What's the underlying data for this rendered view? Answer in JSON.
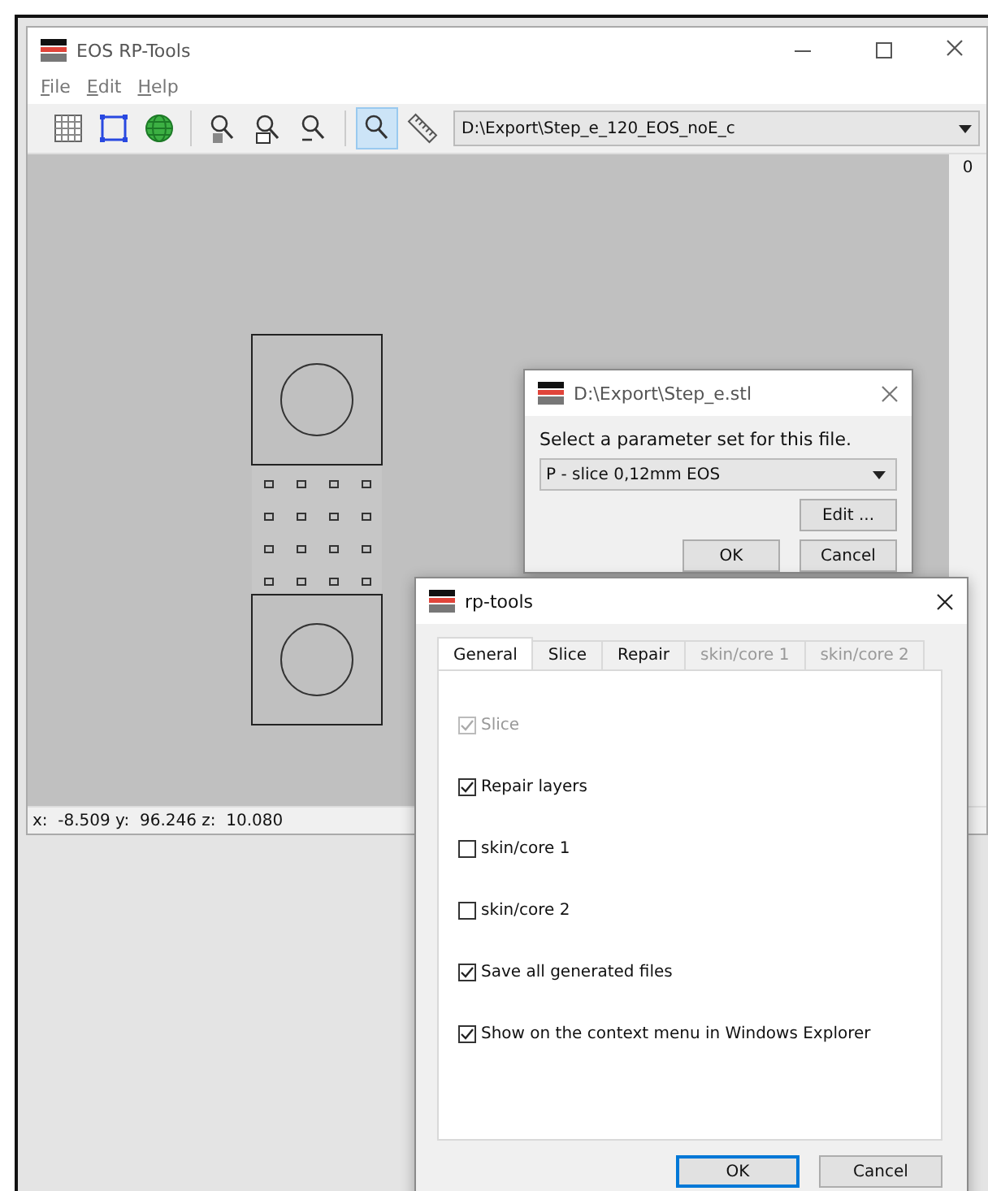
{
  "main_window": {
    "title": "EOS RP-Tools",
    "menu": [
      "File",
      "Edit",
      "Help"
    ],
    "toolbar": [
      {
        "kind": "grid",
        "selected": false
      },
      {
        "kind": "select",
        "selected": false
      },
      {
        "kind": "globe",
        "selected": false
      },
      {
        "kind": "zoom-sel",
        "selected": false
      },
      {
        "kind": "zoom-box",
        "selected": false
      },
      {
        "kind": "zoom-out",
        "selected": false
      },
      {
        "kind": "zoom",
        "selected": true
      },
      {
        "kind": "ruler",
        "selected": false
      }
    ],
    "path_combo": "D:\\Export\\Step_e_120_EOS_noE_c",
    "ruler_label": "0",
    "status_bar": "x:  -8.509 y:  96.246 z:  10.080"
  },
  "parameter_dialog": {
    "title": "D:\\Export\\Step_e.stl",
    "prompt": "Select a parameter set for this file.",
    "parameter_set": "P - slice 0,12mm EOS",
    "buttons": [
      "Edit ...",
      "OK",
      "Cancel"
    ]
  },
  "rp_tools_dialog": {
    "title": "rp-tools",
    "tabs": [
      {
        "label": "General",
        "selected": true,
        "disabled": false
      },
      {
        "label": "Slice",
        "selected": false,
        "disabled": false
      },
      {
        "label": "Repair",
        "selected": false,
        "disabled": false
      },
      {
        "label": "skin/core 1",
        "selected": false,
        "disabled": true
      },
      {
        "label": "skin/core 2",
        "selected": false,
        "disabled": true
      }
    ],
    "options": [
      {
        "label": "Slice",
        "checked": true,
        "disabled": true
      },
      {
        "label": "Repair layers",
        "checked": true,
        "disabled": false
      },
      {
        "label": "skin/core 1",
        "checked": false,
        "disabled": false
      },
      {
        "label": "skin/core 2",
        "checked": false,
        "disabled": false
      },
      {
        "label": "Save all generated files",
        "checked": true,
        "disabled": false
      },
      {
        "label": "Show on the context menu in Windows Explorer",
        "checked": true,
        "disabled": false
      }
    ],
    "buttons": [
      {
        "label": "OK",
        "default": true
      },
      {
        "label": "Cancel",
        "default": false
      }
    ]
  }
}
